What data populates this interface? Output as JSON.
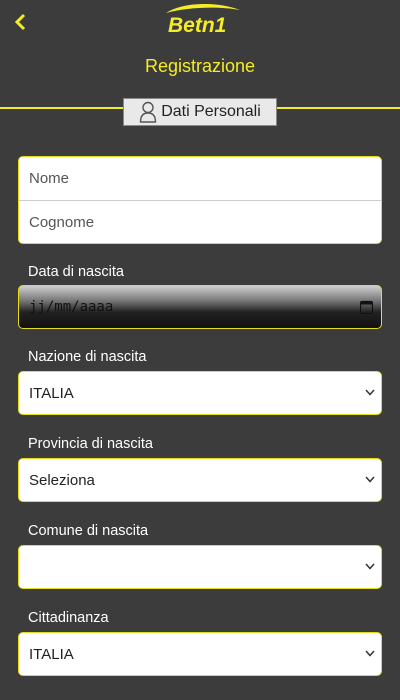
{
  "header": {
    "back_icon": "chevron-left-icon",
    "logo_text": "Betn1",
    "title": "Registrazione"
  },
  "section": {
    "icon": "user-icon",
    "label": "Dati Personali"
  },
  "form": {
    "nome_placeholder": "Nome",
    "cognome_placeholder": "Cognome",
    "birth_date_label": "Data di nascita",
    "birth_date_value": "jj/mm/aaaa",
    "birth_nation_label": "Nazione di nascita",
    "birth_nation_value": "ITALIA",
    "birth_province_label": "Provincia di nascita",
    "birth_province_value": "Seleziona",
    "birth_comune_label": "Comune di nascita",
    "birth_comune_value": "",
    "citizenship_label": "Cittadinanza",
    "citizenship_value": "ITALIA"
  },
  "colors": {
    "accent": "#f4ec24",
    "background": "#3c3c3c",
    "field_border": "#e6dc1e"
  }
}
